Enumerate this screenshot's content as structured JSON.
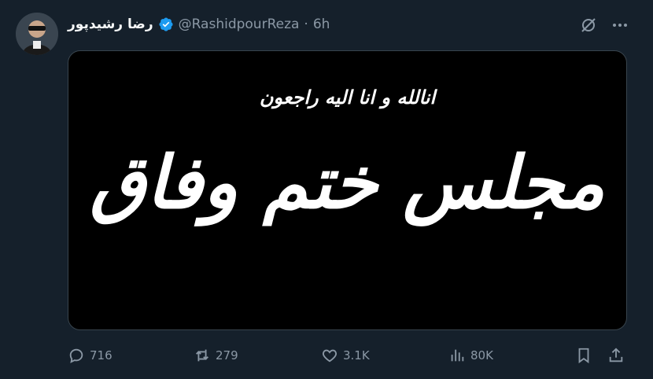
{
  "tweet": {
    "display_name": "رضا رشیدپور",
    "handle": "@RashidpourReza",
    "separator": "·",
    "time": "6h",
    "media": {
      "line1": "انالله و انا الیه راجعون",
      "line2": "مجلس ختم وفاق"
    }
  },
  "actions": {
    "replies": "716",
    "reposts": "279",
    "likes": "3.1K",
    "views": "80K"
  },
  "colors": {
    "background": "#15202b",
    "verified": "#1d9bf0",
    "muted": "#8b98a5"
  },
  "icons": [
    "grok-icon",
    "more-icon",
    "reply-icon",
    "retweet-icon",
    "like-icon",
    "views-icon",
    "bookmark-icon",
    "share-icon",
    "verified-icon"
  ]
}
